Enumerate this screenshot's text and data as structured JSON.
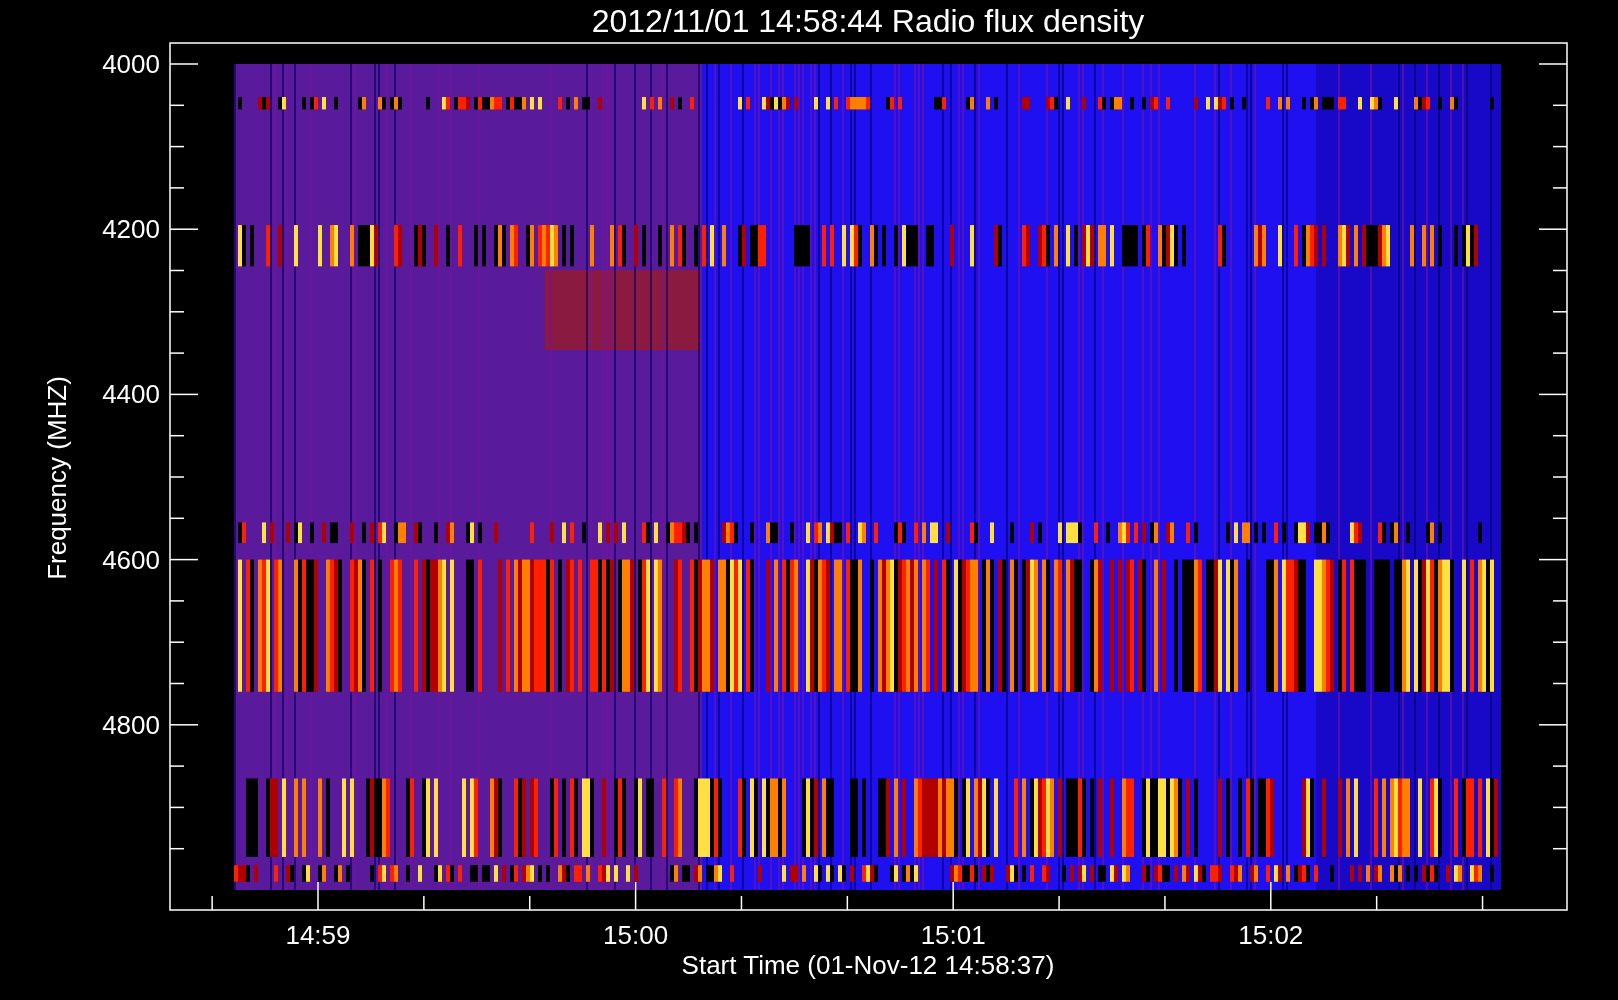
{
  "title": "2012/11/01 14:58:44 Radio flux density",
  "y_axis": {
    "label": "Frequency (MHZ)",
    "ticks": [
      "4000",
      "4200",
      "4400",
      "4600",
      "4800"
    ]
  },
  "x_axis": {
    "label": "Start Time (01-Nov-12 14:58:37)",
    "ticks": [
      "14:59",
      "15:00",
      "15:01",
      "15:02"
    ]
  }
}
